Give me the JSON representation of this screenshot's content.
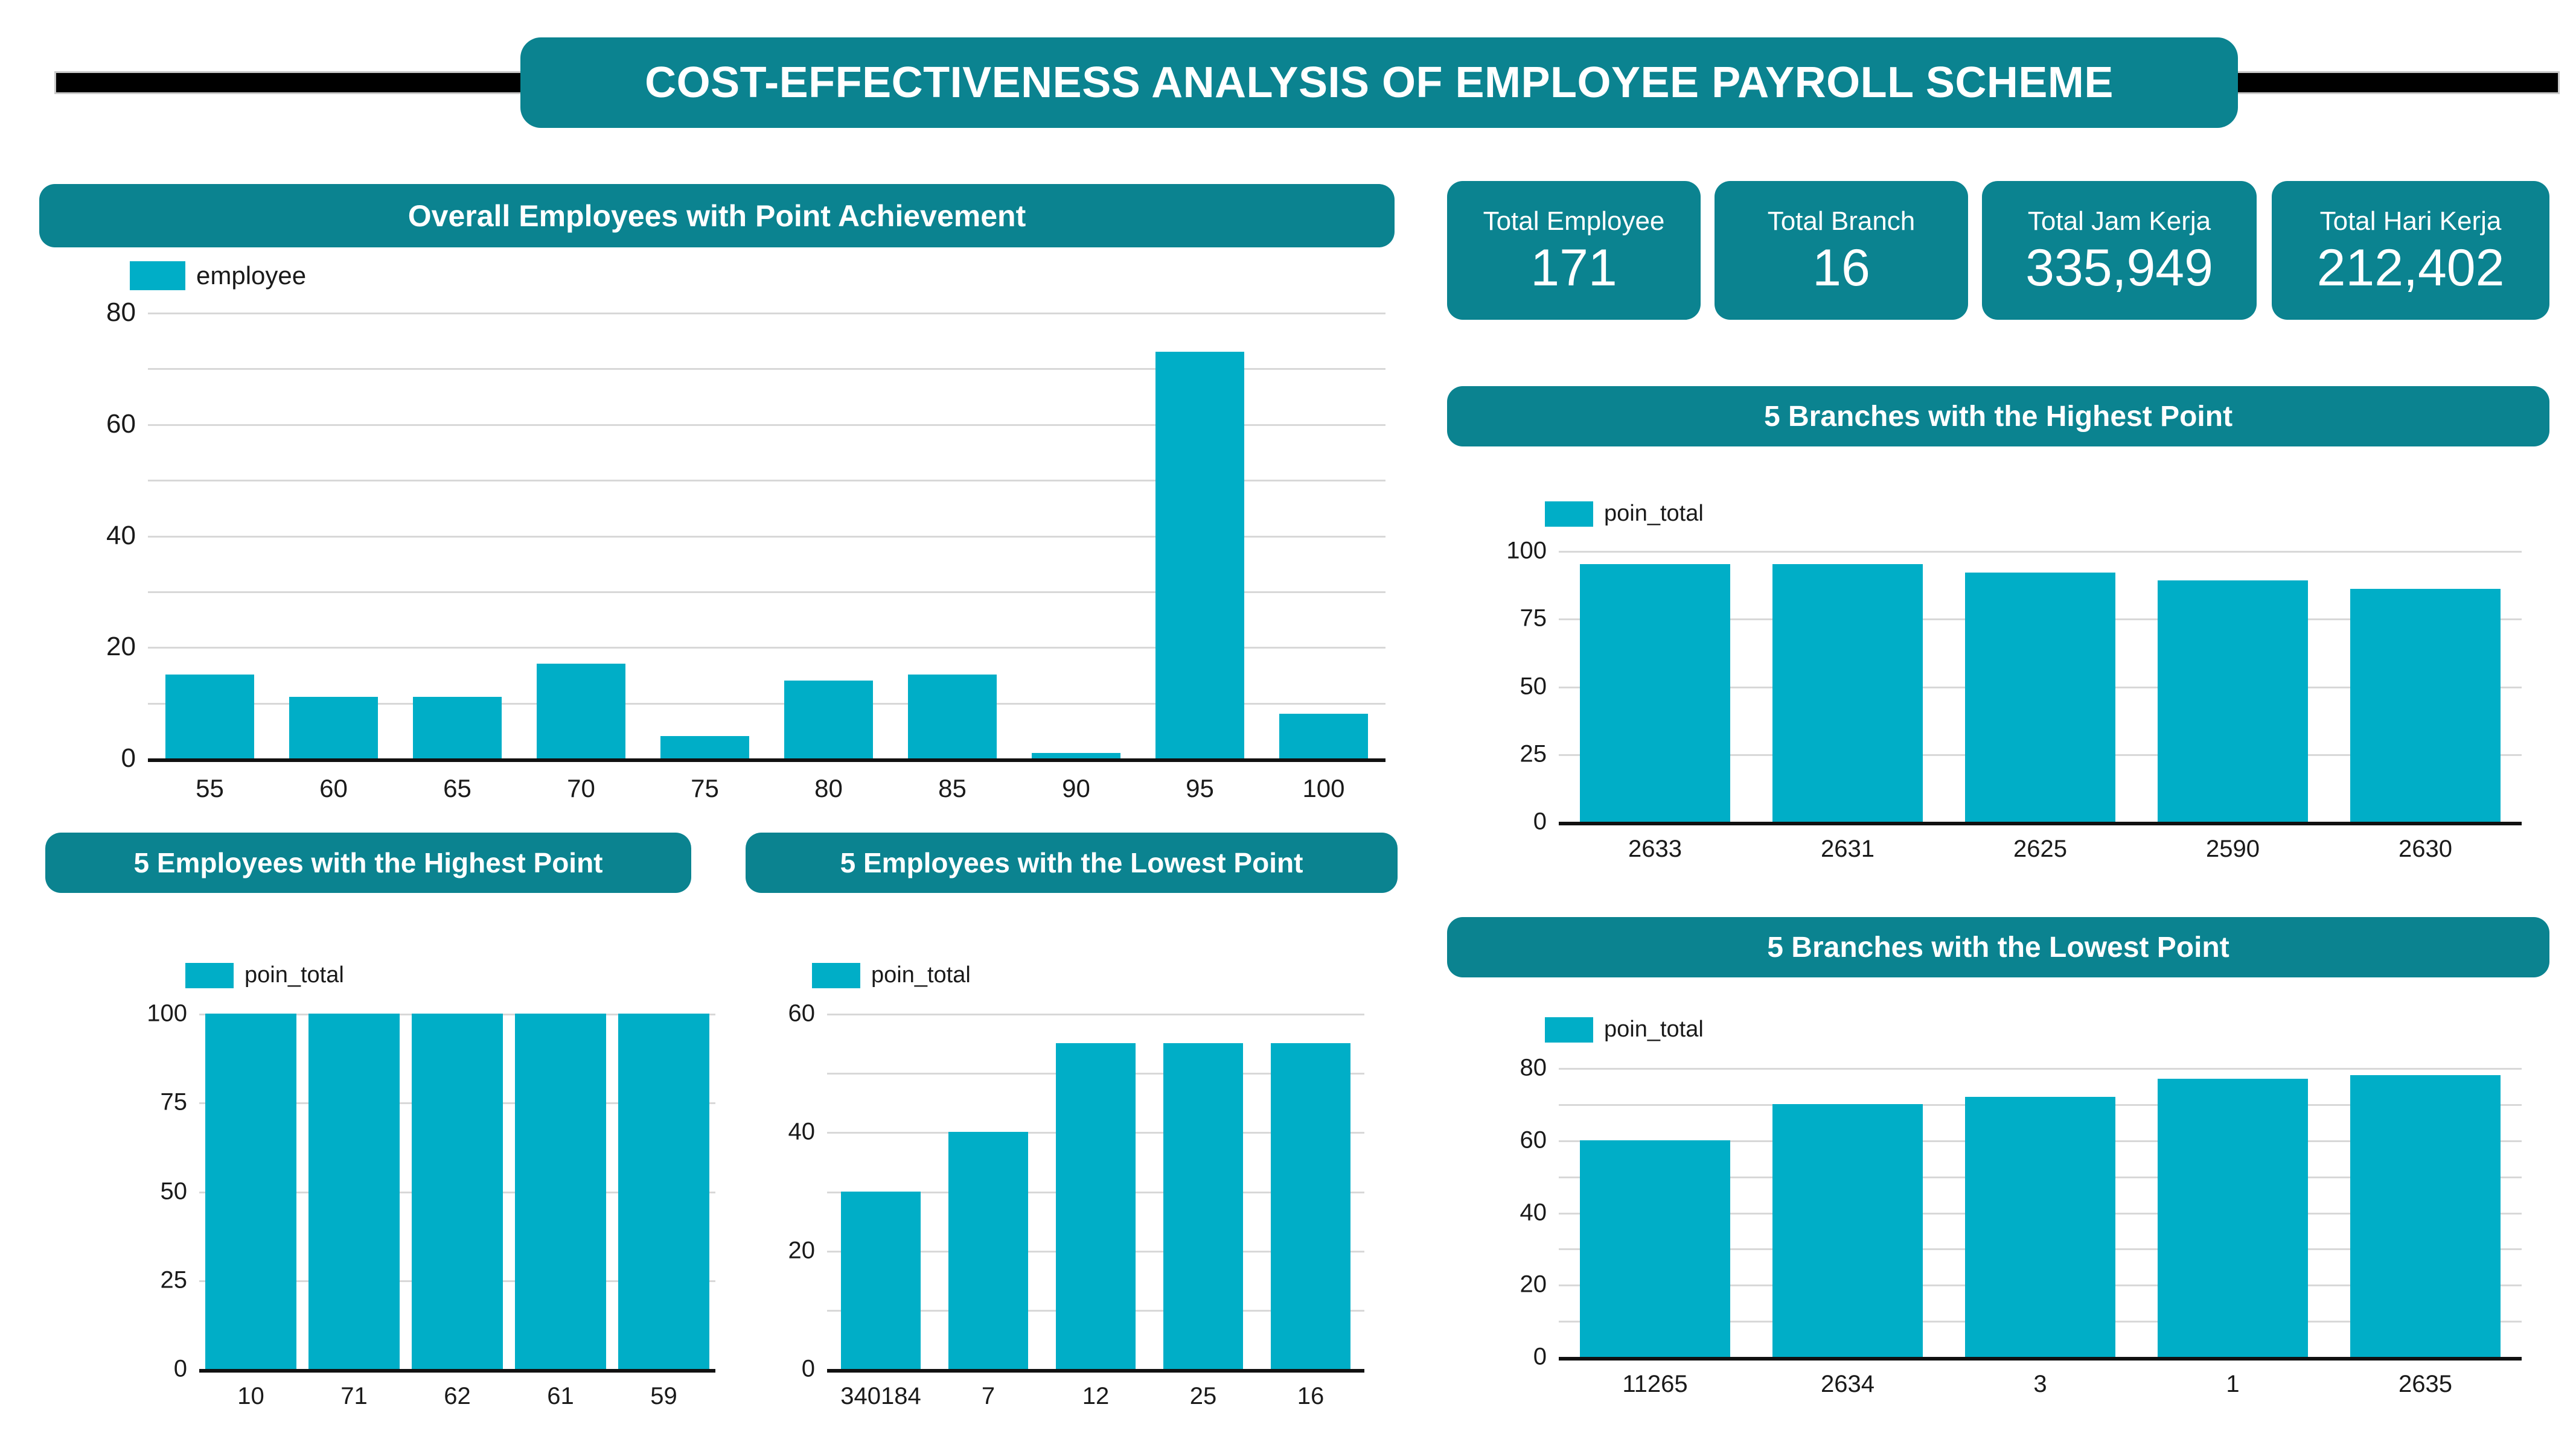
{
  "header": {
    "title": "COST-EFFECTIVENESS ANALYSIS OF EMPLOYEE PAYROLL SCHEME"
  },
  "colors": {
    "panel_header": "#0b8390",
    "bar": "#00aec7",
    "rule": "#000000",
    "background": "#ffffff",
    "grid": "#d8d8d8"
  },
  "kpis": [
    {
      "label": "Total Employee",
      "value": "171"
    },
    {
      "label": "Total Branch",
      "value": "16"
    },
    {
      "label": "Total Jam Kerja",
      "value": "335,949"
    },
    {
      "label": "Total Hari Kerja",
      "value": "212,402"
    }
  ],
  "panels": {
    "overall": {
      "title": "Overall Employees with Point Achievement"
    },
    "employees_highest": {
      "title": "5 Employees with the Highest Point"
    },
    "employees_lowest": {
      "title": "5 Employees with the Lowest Point"
    },
    "branches_highest": {
      "title": "5 Branches with the Highest Point"
    },
    "branches_lowest": {
      "title": "5 Branches with the Lowest Point"
    }
  },
  "chart_data": [
    {
      "id": "overall",
      "type": "bar",
      "title": "Overall Employees with Point Achievement",
      "legend": [
        "employee"
      ],
      "legend_position": "top-left",
      "categories": [
        "55",
        "60",
        "65",
        "70",
        "75",
        "80",
        "85",
        "90",
        "95",
        "100"
      ],
      "values": [
        15,
        11,
        11,
        17,
        4,
        14,
        15,
        1,
        73,
        8
      ],
      "xlabel": "",
      "ylabel": "",
      "ylim": [
        0,
        80
      ],
      "yticks": [
        0,
        20,
        40,
        60,
        80
      ],
      "gridlines": [
        10,
        20,
        30,
        40,
        50,
        60,
        70,
        80
      ],
      "grid": true
    },
    {
      "id": "employees_highest",
      "type": "bar",
      "title": "5 Employees with the Highest Point",
      "legend": [
        "poin_total"
      ],
      "legend_position": "top-left",
      "categories": [
        "10",
        "71",
        "62",
        "61",
        "59"
      ],
      "values": [
        100,
        100,
        100,
        100,
        100
      ],
      "xlabel": "",
      "ylabel": "",
      "ylim": [
        0,
        100
      ],
      "yticks": [
        0,
        25,
        50,
        75,
        100
      ],
      "gridlines": [
        25,
        50,
        75,
        100
      ],
      "grid": true
    },
    {
      "id": "employees_lowest",
      "type": "bar",
      "title": "5 Employees with the Lowest Point",
      "legend": [
        "poin_total"
      ],
      "legend_position": "top-left",
      "categories": [
        "340184",
        "7",
        "12",
        "25",
        "16"
      ],
      "values": [
        30,
        40,
        55,
        55,
        55
      ],
      "xlabel": "",
      "ylabel": "",
      "ylim": [
        0,
        60
      ],
      "yticks": [
        0,
        20,
        40,
        60
      ],
      "gridlines": [
        10,
        20,
        30,
        40,
        50,
        60
      ],
      "grid": true
    },
    {
      "id": "branches_highest",
      "type": "bar",
      "title": "5 Branches with the Highest Point",
      "legend": [
        "poin_total"
      ],
      "legend_position": "top-left",
      "categories": [
        "2633",
        "2631",
        "2625",
        "2590",
        "2630"
      ],
      "values": [
        95,
        95,
        92,
        89,
        86
      ],
      "xlabel": "",
      "ylabel": "",
      "ylim": [
        0,
        100
      ],
      "yticks": [
        0,
        25,
        50,
        75,
        100
      ],
      "gridlines": [
        25,
        50,
        75,
        100
      ],
      "grid": true
    },
    {
      "id": "branches_lowest",
      "type": "bar",
      "title": "5 Branches with the Lowest Point",
      "legend": [
        "poin_total"
      ],
      "legend_position": "top-left",
      "categories": [
        "11265",
        "2634",
        "3",
        "1",
        "2635"
      ],
      "values": [
        60,
        70,
        72,
        77,
        78
      ],
      "xlabel": "",
      "ylabel": "",
      "ylim": [
        0,
        80
      ],
      "yticks": [
        0,
        20,
        40,
        60,
        80
      ],
      "gridlines": [
        10,
        20,
        30,
        40,
        50,
        60,
        70,
        80
      ],
      "grid": true
    }
  ]
}
